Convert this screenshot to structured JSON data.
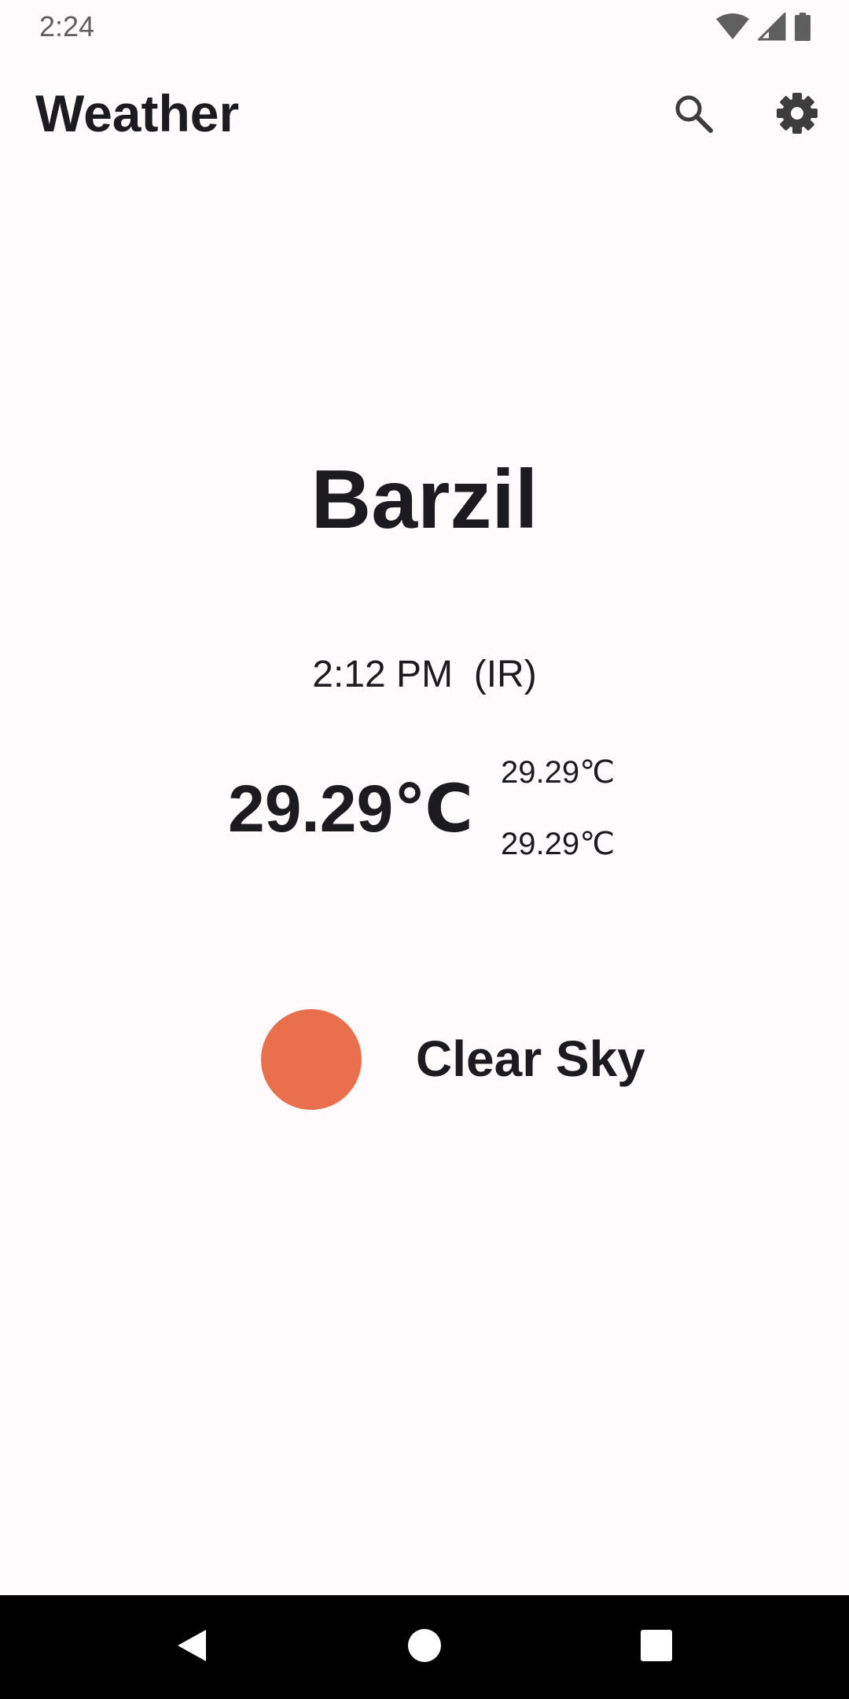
{
  "status_bar": {
    "time": "2:24",
    "icons": [
      "wifi-icon",
      "signal-icon",
      "battery-icon"
    ]
  },
  "app_bar": {
    "title": "Weather",
    "actions": [
      "search-icon",
      "settings-icon"
    ]
  },
  "weather": {
    "city": "Barzil",
    "local_time": "2:12 PM",
    "timezone": "(IR)",
    "temperature": "29.29℃",
    "temp_max": "29.29℃",
    "temp_min": "29.29℃",
    "condition": "Clear Sky",
    "condition_icon_color": "#ea6f4c"
  },
  "nav_bar": {
    "buttons": [
      "back-icon",
      "home-icon",
      "recents-icon"
    ]
  },
  "colors": {
    "background": "#fffbfd",
    "text": "#1c1b1f",
    "nav_background": "#000000"
  }
}
